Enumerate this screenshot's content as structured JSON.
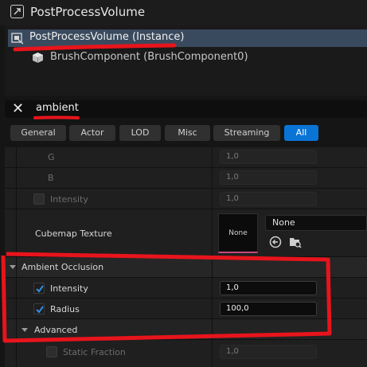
{
  "header": {
    "title": "PostProcessVolume"
  },
  "tree": {
    "items": [
      {
        "label": "PostProcessVolume (Instance)"
      },
      {
        "label": "BrushComponent (BrushComponent0)"
      }
    ]
  },
  "search": {
    "value": "ambient"
  },
  "tabs": [
    {
      "label": "General"
    },
    {
      "label": "Actor"
    },
    {
      "label": "LOD"
    },
    {
      "label": "Misc"
    },
    {
      "label": "Streaming"
    },
    {
      "label": "All"
    }
  ],
  "properties": {
    "g": {
      "label": "G",
      "value": "1,0"
    },
    "b": {
      "label": "B",
      "value": "1,0"
    },
    "intensity_top": {
      "label": "Intensity",
      "value": "1,0"
    },
    "cubemap": {
      "label": "Cubemap Texture",
      "thumb": "None",
      "combo": "None"
    },
    "ao_section": {
      "label": "Ambient Occlusion"
    },
    "ao_intensity": {
      "label": "Intensity",
      "value": "1,0"
    },
    "ao_radius": {
      "label": "Radius",
      "value": "100,0"
    },
    "advanced": {
      "label": "Advanced"
    },
    "static_fraction": {
      "label": "Static Fraction",
      "value": "1,0"
    }
  },
  "colors": {
    "accent": "#0a74d6",
    "annotation": "#e8141c",
    "selection": "#3a4a5e"
  }
}
